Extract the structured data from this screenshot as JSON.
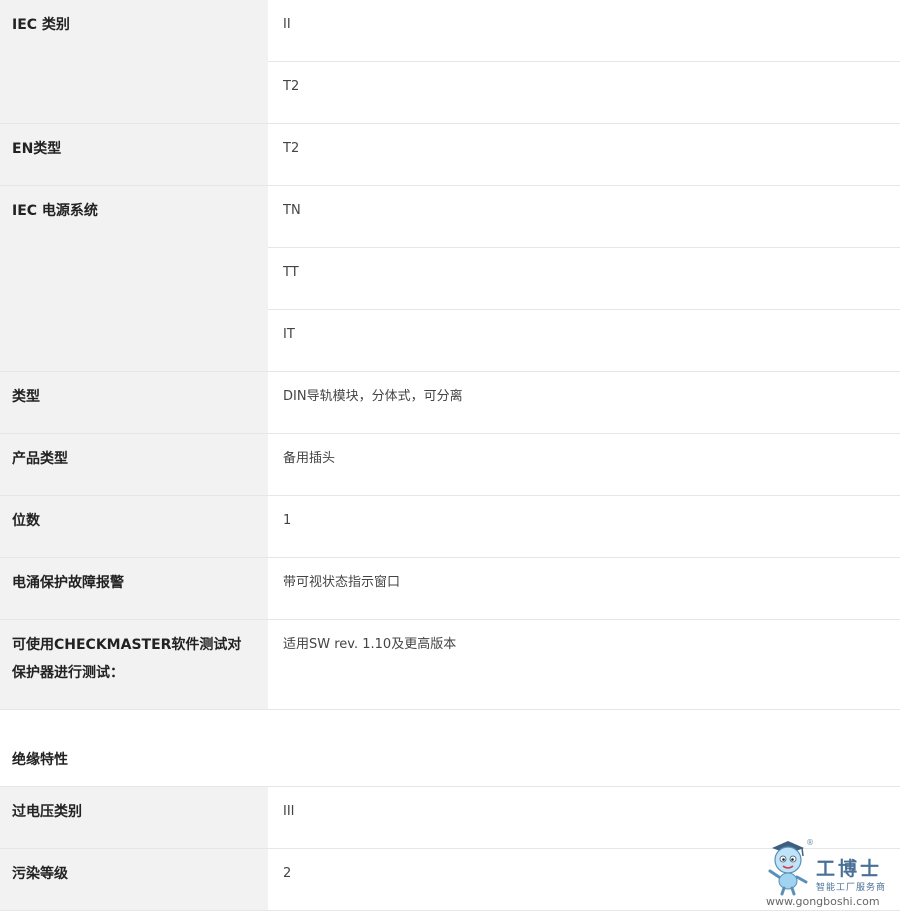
{
  "spec_table": {
    "rows": [
      {
        "label": "IEC 类别",
        "values": [
          "II",
          "T2"
        ]
      },
      {
        "label": "EN类型",
        "values": [
          "T2"
        ]
      },
      {
        "label": "IEC 电源系统",
        "values": [
          "TN",
          "TT",
          "IT"
        ]
      },
      {
        "label": "类型",
        "values": [
          "DIN导轨模块，分体式，可分离"
        ]
      },
      {
        "label": "产品类型",
        "values": [
          "备用插头"
        ]
      },
      {
        "label": "位数",
        "values": [
          "1"
        ]
      },
      {
        "label": "电涌保护故障报警",
        "values": [
          "带可视状态指示窗口"
        ]
      },
      {
        "label": "可使用CHECKMASTER软件测试对保护器进行测试：",
        "values": [
          "适用SW rev. 1.10及更高版本"
        ]
      }
    ]
  },
  "insulation_section": {
    "title": "绝缘特性",
    "rows": [
      {
        "label": "过电压类别",
        "values": [
          "III"
        ]
      },
      {
        "label": "污染等级",
        "values": [
          "2"
        ]
      }
    ]
  },
  "watermark": {
    "registered": "®",
    "title": "工博士",
    "subtitle": "智能工厂服务商",
    "url": "www.gongboshi.com"
  }
}
